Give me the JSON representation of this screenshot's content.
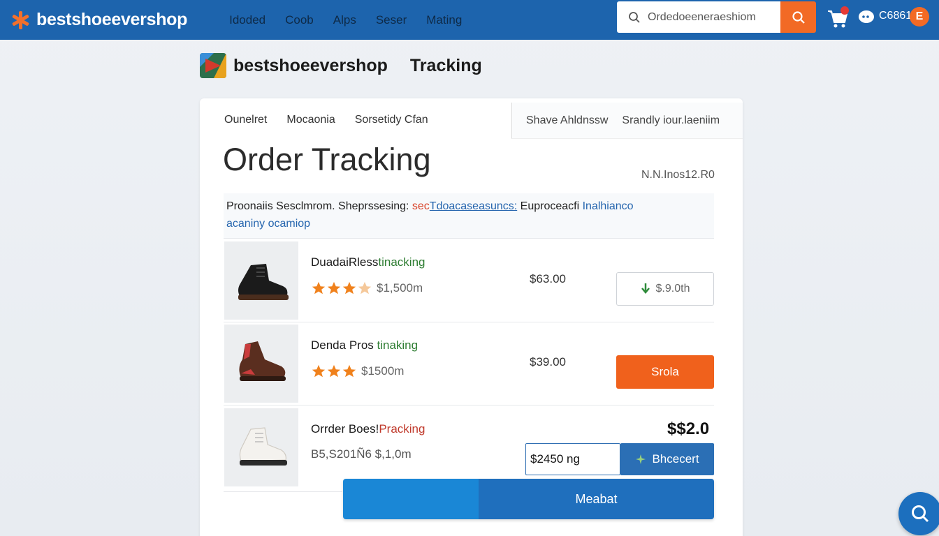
{
  "header": {
    "brand": "bestshoeevershop",
    "nav": [
      "Idoded",
      "Coob",
      "Alps",
      "Seser",
      "Mating"
    ],
    "search_placeholder": "Ordedoeeneraeshiom",
    "account_text": "C6861",
    "account_badge": "E"
  },
  "subheader": {
    "brand": "bestshoeevershop",
    "title": "Tracking"
  },
  "card": {
    "tabs": [
      "Ounelret",
      "Mocaonia",
      "Sorsetidy Cfan"
    ],
    "tabs_right": [
      "Shave Ahldnssw",
      "Srandly iour.laeniim"
    ],
    "title": "Order Tracking",
    "order_id": "N.N.Inos12.R0",
    "info": {
      "part1": "Proonaiis Sesclmrom. Sheprssesing:",
      "part2": "sec",
      "part3": "Tdoacaseasuncs:",
      "part4": "Euproceacfi",
      "part5": "Inalhianco",
      "part6": "acaniny ocamiop"
    }
  },
  "products": [
    {
      "name_a": "DuadaiRless",
      "name_b": "tinacking",
      "rating_stars": 3.5,
      "rating_text": "$1,500m",
      "price": "$63.00",
      "action": "$.9.0th"
    },
    {
      "name_a": "Denda Pros ",
      "name_b": "tinaking",
      "rating_stars": 3,
      "rating_text": "$1500m",
      "price": "$39.00",
      "action": "Srola"
    },
    {
      "name_a": "Orrder Boes!",
      "name_b": "Pracking",
      "sku": "B5,S201Ñ6 $,1,0m",
      "price": "$$2.0",
      "qty_value": "$2450 ng",
      "action": "Bhcecert"
    }
  ],
  "main_action": "Meabat",
  "colors": {
    "header_blue": "#1d64ad",
    "accent_orange": "#f0611c",
    "button_blue": "#2b6fb5",
    "star_orange": "#f0811c"
  },
  "icons": [
    "search-icon",
    "cart-icon",
    "chat-icon",
    "arrow-down-icon",
    "sparkle-icon",
    "chat-search-icon"
  ]
}
